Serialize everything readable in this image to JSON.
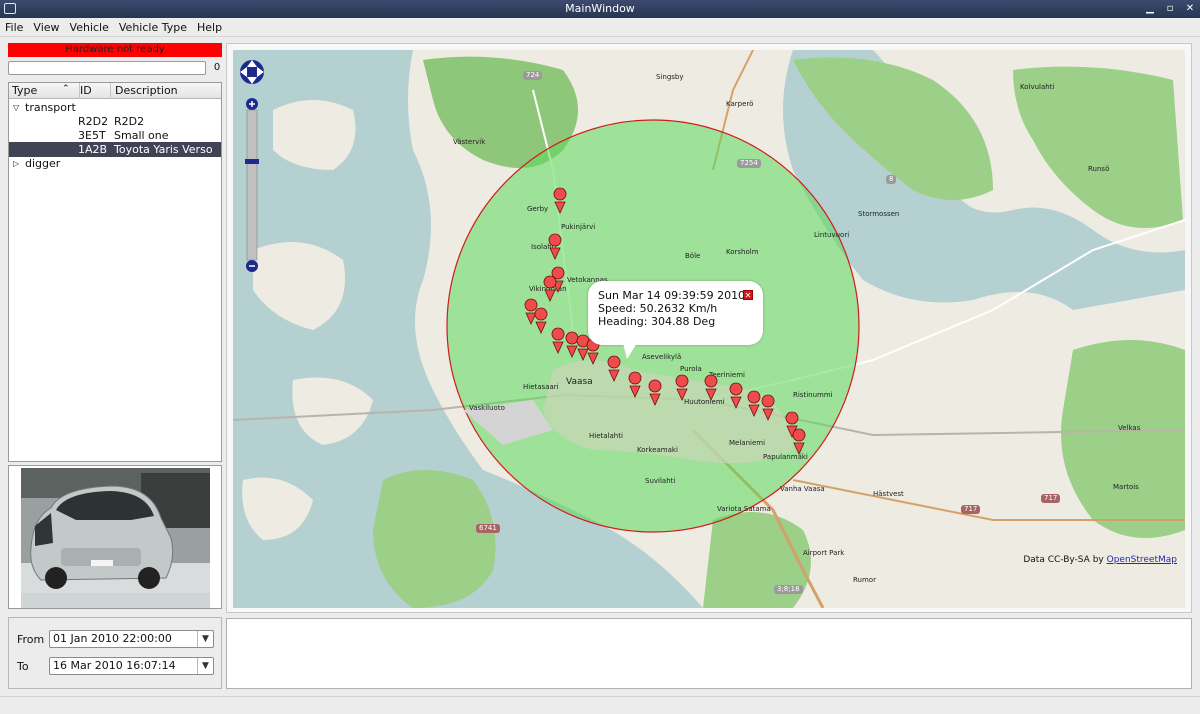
{
  "window": {
    "title": "MainWindow"
  },
  "menu": [
    {
      "label": "File"
    },
    {
      "label": "View"
    },
    {
      "label": "Vehicle"
    },
    {
      "label": "Vehicle Type"
    },
    {
      "label": "Help"
    }
  ],
  "hardware_status": {
    "text": "Hardware not ready",
    "color": "#ff0000"
  },
  "progress": {
    "value_text": "0",
    "percent": 0
  },
  "tree": {
    "columns": [
      "Type",
      "ID",
      "Description"
    ],
    "sort_column": "Type",
    "groups": [
      {
        "label": "transport",
        "expanded": true,
        "items": [
          {
            "id": "R2D2",
            "description": "R2D2",
            "selected": false
          },
          {
            "id": "3E5T",
            "description": "Small one",
            "selected": false
          },
          {
            "id": "1A2B",
            "description": "Toyota Yaris Verso",
            "selected": true
          }
        ]
      },
      {
        "label": "digger",
        "expanded": false,
        "items": []
      }
    ]
  },
  "vehicle_photo": {
    "subject": "car-photo",
    "plate": "BSV-880"
  },
  "map": {
    "popup": {
      "time": "Sun Mar 14 09:39:59 2010",
      "speed": "Speed: 50.2632 Km/h",
      "heading": "Heading: 304.88 Deg"
    },
    "attribution_prefix": "Data CC-By-SA by",
    "attribution_link": "OpenStreetMap",
    "place_labels": [
      "Singsby",
      "Karperö",
      "Västervik",
      "Gerby",
      "Pukinjärvi",
      "Isolahti",
      "Böle",
      "Korsholm",
      "Vetokannas",
      "Vikinggrän",
      "Asevelikylä",
      "Purola",
      "Teeriniemi",
      "Ristinummi",
      "Vaasa",
      "Hietasaari",
      "Vaskiluoto",
      "Huutoniemi",
      "Melaniemi",
      "Hietalahti",
      "Korkeamaki",
      "Suvilahti",
      "Papulanmäki",
      "Vanha Vaasa",
      "Variota Satama",
      "Airport Park",
      "Rumor",
      "Hästvest",
      "Martois",
      "Velkas",
      "Kolvulahti",
      "Stormossen",
      "Lintuvuori",
      "Runsö"
    ],
    "road_shields": [
      "724",
      "7254",
      "8",
      "6741",
      "717",
      "717",
      "3;8;18"
    ],
    "colors": {
      "circle_fill": "#5cd95c",
      "circle_stroke": "#d21a1a",
      "marker": "#f04b4b"
    }
  },
  "dates": {
    "from_label": "From",
    "from_value": "01 Jan 2010 22:00:00",
    "to_label": "To",
    "to_value": "16 Mar 2010 16:07:14"
  },
  "log": {
    "text": ""
  }
}
